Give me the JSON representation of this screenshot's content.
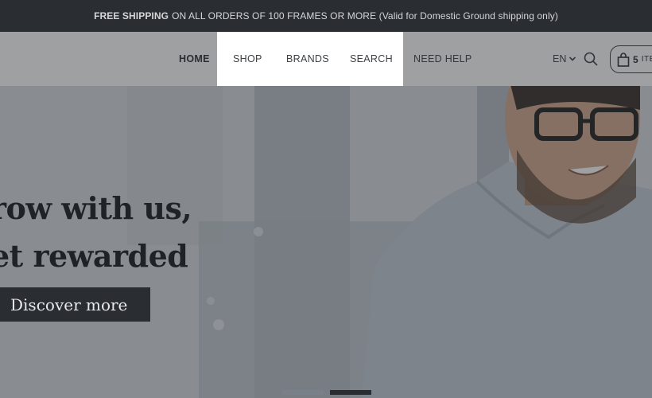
{
  "promo": {
    "strong": "FREE SHIPPING",
    "text": "ON ALL ORDERS OF 100 FRAMES OR MORE (Valid for Domestic Ground shipping only)"
  },
  "nav": {
    "items": [
      "HOME",
      "SHOP",
      "BRANDS",
      "SEARCH",
      "NEED HELP"
    ],
    "language": "EN",
    "cart_count": "5",
    "cart_unit": "ITE"
  },
  "hero": {
    "heading_line1": "row with us,",
    "heading_line2": "et rewarded",
    "cta": "Discover more"
  },
  "colors": {
    "dark": "#2a2e33",
    "overlay": "rgba(40,44,48,0.45)"
  }
}
